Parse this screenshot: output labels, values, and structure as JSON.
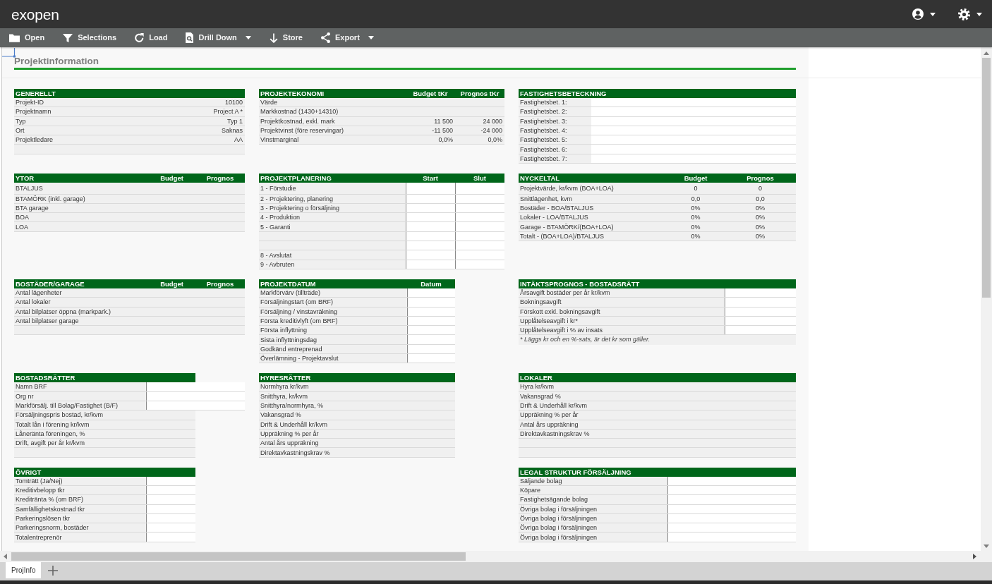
{
  "app": {
    "logo": "exopen"
  },
  "toolbar": [
    {
      "label": "Open",
      "dropdown": false
    },
    {
      "label": "Selections",
      "dropdown": false
    },
    {
      "label": "Load",
      "dropdown": false
    },
    {
      "label": "Drill Down",
      "dropdown": true
    },
    {
      "label": "Store",
      "dropdown": false
    },
    {
      "label": "Export",
      "dropdown": true
    }
  ],
  "sheet": {
    "title": "Projektinformation",
    "sections": [
      {
        "title": "GENERELLT",
        "rows": [
          {
            "kind": "value",
            "label": "Projekt-ID",
            "values": [
              "10100"
            ]
          },
          {
            "kind": "value",
            "label": "Projektnamn",
            "values": [
              "Project A *"
            ]
          },
          {
            "kind": "value",
            "label": "Typ",
            "values": [
              "Typ 1"
            ]
          },
          {
            "kind": "value",
            "label": "Ort",
            "values": [
              "Saknas"
            ]
          },
          {
            "kind": "value",
            "label": "Projektledare",
            "values": [
              "AA"
            ]
          },
          {
            "kind": "blank"
          }
        ]
      },
      {
        "title": "PROJEKTEKONOMI",
        "columns": [
          "Budget tKr",
          "Prognos tKr"
        ],
        "rows": [
          {
            "kind": "value",
            "label": "Värde"
          },
          {
            "kind": "value",
            "label": "Markkostnad (1430+14310)"
          },
          {
            "kind": "value",
            "label": "Projektkostnad, exkl. mark",
            "values": [
              "11 500",
              "24 000"
            ]
          },
          {
            "kind": "value",
            "label": "Projektvinst (före reservingar)",
            "values": [
              "-11 500",
              "-24 000"
            ]
          },
          {
            "kind": "value",
            "label": "Vinstmarginal",
            "values": [
              "0,0%",
              "0,0%"
            ]
          }
        ]
      },
      {
        "title": "FASTIGHETSBETECKNING",
        "rows": [
          {
            "kind": "input",
            "label": "Fastighetsbet. 1:"
          },
          {
            "kind": "input",
            "label": "Fastighetsbet. 2:"
          },
          {
            "kind": "input",
            "label": "Fastighetsbet. 3:"
          },
          {
            "kind": "input",
            "label": "Fastighetsbet. 4:"
          },
          {
            "kind": "input",
            "label": "Fastighetsbet. 5:"
          },
          {
            "kind": "input",
            "label": "Fastighetsbet. 6:"
          },
          {
            "kind": "input",
            "label": "Fastighetsbet. 7:"
          }
        ]
      },
      {
        "title": "YTOR",
        "columns": [
          "Budget",
          "Prognos"
        ],
        "rows": [
          {
            "kind": "value",
            "label": "BTALJUS"
          },
          {
            "kind": "value",
            "label": "BTAMÖRK (inkl. garage)"
          },
          {
            "kind": "value",
            "label": "BTA garage"
          },
          {
            "kind": "value",
            "label": "BOA"
          },
          {
            "kind": "value",
            "label": "LOA"
          }
        ]
      },
      {
        "title": "PROJEKTPLANERING",
        "columns": [
          "Start",
          "Slut"
        ],
        "rows": [
          {
            "kind": "input",
            "label": "1 - Förstudie"
          },
          {
            "kind": "input",
            "label": "2 - Projektering, planering"
          },
          {
            "kind": "input",
            "label": "3 - Projektering o försäljning"
          },
          {
            "kind": "input",
            "label": "4 - Produktion"
          },
          {
            "kind": "input",
            "label": "5 - Garanti"
          },
          {
            "kind": "input"
          },
          {
            "kind": "input"
          },
          {
            "kind": "input",
            "label": "8 - Avslutat"
          },
          {
            "kind": "input",
            "label": "9 - Avbruten"
          }
        ]
      },
      {
        "title": "NYCKELTAL",
        "columns": [
          "Budget",
          "Prognos"
        ],
        "rows": [
          {
            "kind": "value",
            "label": "Projektvärde, kr/kvm (BOA+LOA)",
            "values": [
              "0",
              "0"
            ]
          },
          {
            "kind": "value",
            "label": "Snittlägenhet, kvm",
            "values": [
              "0,0",
              "0,0"
            ]
          },
          {
            "kind": "value",
            "label": "Bostäder - BOA/BTALJUS",
            "values": [
              "0%",
              "0%"
            ]
          },
          {
            "kind": "value",
            "label": "Lokaler - LOA/BTALJUS",
            "values": [
              "0%",
              "0%"
            ]
          },
          {
            "kind": "value",
            "label": "Garage - BTAMÖRK/(BOA+LOA)",
            "values": [
              "0%",
              "0%"
            ]
          },
          {
            "kind": "value",
            "label": "Totalt - (BOA+LOA)/BTALJUS",
            "values": [
              "0%",
              "0%"
            ]
          }
        ]
      },
      {
        "title": "BOSTÄDER/GARAGE",
        "columns": [
          "Budget",
          "Prognos"
        ],
        "rows": [
          {
            "kind": "value",
            "label": "Antal lägenheter"
          },
          {
            "kind": "value",
            "label": "Antal lokaler"
          },
          {
            "kind": "value",
            "label": "Antal bilplatser öppna (markpark.)"
          },
          {
            "kind": "value",
            "label": "Antal bilplatser garage"
          },
          {
            "kind": "blank"
          }
        ]
      },
      {
        "title": "PROJEKTDATUM",
        "columns": [
          "Datum"
        ],
        "rows": [
          {
            "kind": "input",
            "label": "Markförvärv (tillträde)"
          },
          {
            "kind": "input",
            "label": "Försäljningstart (om BRF)"
          },
          {
            "kind": "input",
            "label": "Försäljning / vinstavräkning"
          },
          {
            "kind": "input",
            "label": "Första kreditivlyft (om BRF)"
          },
          {
            "kind": "input",
            "label": "Första inflyttning"
          },
          {
            "kind": "input",
            "label": "Sista inflyttningsdag"
          },
          {
            "kind": "input",
            "label": "Godkänd entreprenad"
          },
          {
            "kind": "input",
            "label": "Överlämning - Projektavslut"
          }
        ]
      },
      {
        "title": "INTÄKTSPROGNOS - BOSTADSRÄTT",
        "rows": [
          {
            "kind": "input",
            "label": "Årsavgift bostäder per år kr/kvm"
          },
          {
            "kind": "input",
            "label": "Bokningsavgift"
          },
          {
            "kind": "input",
            "label": "Förskott exkl. bokningsavgift"
          },
          {
            "kind": "input",
            "label": "Upplåtelseavgift i kr*"
          },
          {
            "kind": "input",
            "label": "Upplåtelseavgift i % av insats"
          }
        ],
        "note": "* Läggs kr och en %-sats, är det kr som gäller."
      },
      {
        "title": "BOSTADSRÄTTER",
        "rows": [
          {
            "kind": "input",
            "label": "Namn BRF"
          },
          {
            "kind": "input",
            "label": "Org nr"
          },
          {
            "kind": "input",
            "label": "Markförsälj. till Bolag/Fastighet (B/F)"
          },
          {
            "kind": "value",
            "label": "Försäljningspris bostad, kr/kvm"
          },
          {
            "kind": "value",
            "label": "Totalt lån i förening kr/kvm"
          },
          {
            "kind": "value",
            "label": "Låneränta föreningen, %"
          },
          {
            "kind": "value",
            "label": "Drift, avgift per år kr/kvm"
          },
          {
            "kind": "blank"
          }
        ]
      },
      {
        "title": "HYRESRÄTTER",
        "rows": [
          {
            "kind": "value",
            "label": "Normhyra kr/kvm"
          },
          {
            "kind": "value",
            "label": "Snitthyra, kr/kvm"
          },
          {
            "kind": "value",
            "label": "Snitthyra/normhyra, %"
          },
          {
            "kind": "value",
            "label": "Vakansgrad %"
          },
          {
            "kind": "value",
            "label": "Drift & Underhåll kr/kvm"
          },
          {
            "kind": "value",
            "label": "Uppräkning % per år"
          },
          {
            "kind": "value",
            "label": "Antal års uppräkning"
          },
          {
            "kind": "value",
            "label": "Direktavkastningskrav %"
          }
        ]
      },
      {
        "title": "LOKALER",
        "rows": [
          {
            "kind": "value",
            "label": "Hyra kr/kvm"
          },
          {
            "kind": "value",
            "label": "Vakansgrad %"
          },
          {
            "kind": "value",
            "label": "Drift & Underhåll kr/kvm"
          },
          {
            "kind": "value",
            "label": "Uppräkning % per år"
          },
          {
            "kind": "value",
            "label": "Antal års uppräkning"
          },
          {
            "kind": "value",
            "label": "Direktavkastningskrav %"
          },
          {
            "kind": "blank"
          },
          {
            "kind": "blank"
          }
        ]
      },
      {
        "title": "ÖVRIGT",
        "rows": [
          {
            "kind": "input",
            "label": "Tomträtt (Ja/Nej)"
          },
          {
            "kind": "input",
            "label": "Kreditivbelopp tkr"
          },
          {
            "kind": "input",
            "label": "Kreditränta % (om BRF)"
          },
          {
            "kind": "input",
            "label": "Samfällighetskostnad tkr"
          },
          {
            "kind": "input",
            "label": "Parkeringslösen tkr"
          },
          {
            "kind": "input",
            "label": "Parkeringsnorm, bostäder"
          },
          {
            "kind": "input",
            "label": "Totalentreprenör"
          }
        ]
      },
      {
        "title": "LEGAL STRUKTUR FÖRSÄLJNING",
        "rows": [
          {
            "kind": "input",
            "label": "Säljande bolag"
          },
          {
            "kind": "input",
            "label": "Köpare"
          },
          {
            "kind": "input",
            "label": "Fastighetsägande bolag"
          },
          {
            "kind": "input",
            "label": "Övriga bolag i försäljningen"
          },
          {
            "kind": "input",
            "label": "Övriga bolag i försäljningen"
          },
          {
            "kind": "input",
            "label": "Övriga bolag i försäljningen"
          },
          {
            "kind": "input",
            "label": "Övriga bolag i försäljningen"
          }
        ]
      }
    ]
  },
  "sheet_tabs": [
    {
      "label": "ProjInfo",
      "selected": true
    }
  ]
}
